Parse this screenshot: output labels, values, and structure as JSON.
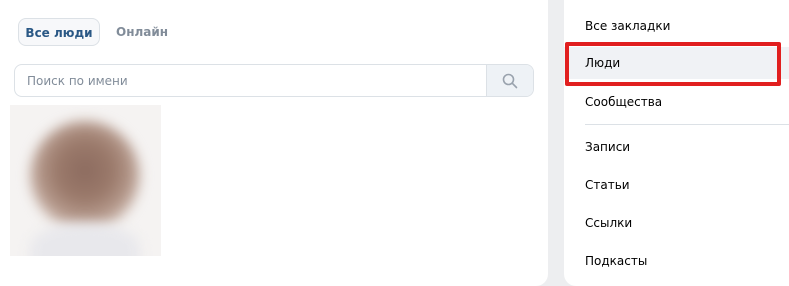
{
  "tabs": [
    {
      "label": "Все люди",
      "active": true
    },
    {
      "label": "Онлайн",
      "active": false
    }
  ],
  "search": {
    "placeholder": "Поиск по имени",
    "value": "",
    "icon": "search-icon"
  },
  "sidebar": {
    "items": [
      {
        "label": "Все закладки"
      },
      {
        "label": "Люди",
        "selected": true
      },
      {
        "label": "Сообщества"
      },
      {
        "label": "Записи"
      },
      {
        "label": "Статьи"
      },
      {
        "label": "Ссылки"
      },
      {
        "label": "Подкасты"
      }
    ]
  },
  "colors": {
    "accent_text": "#2a5885",
    "muted_text": "#818c99",
    "highlight": "#e11f1f",
    "page_bg": "#edeef0"
  }
}
